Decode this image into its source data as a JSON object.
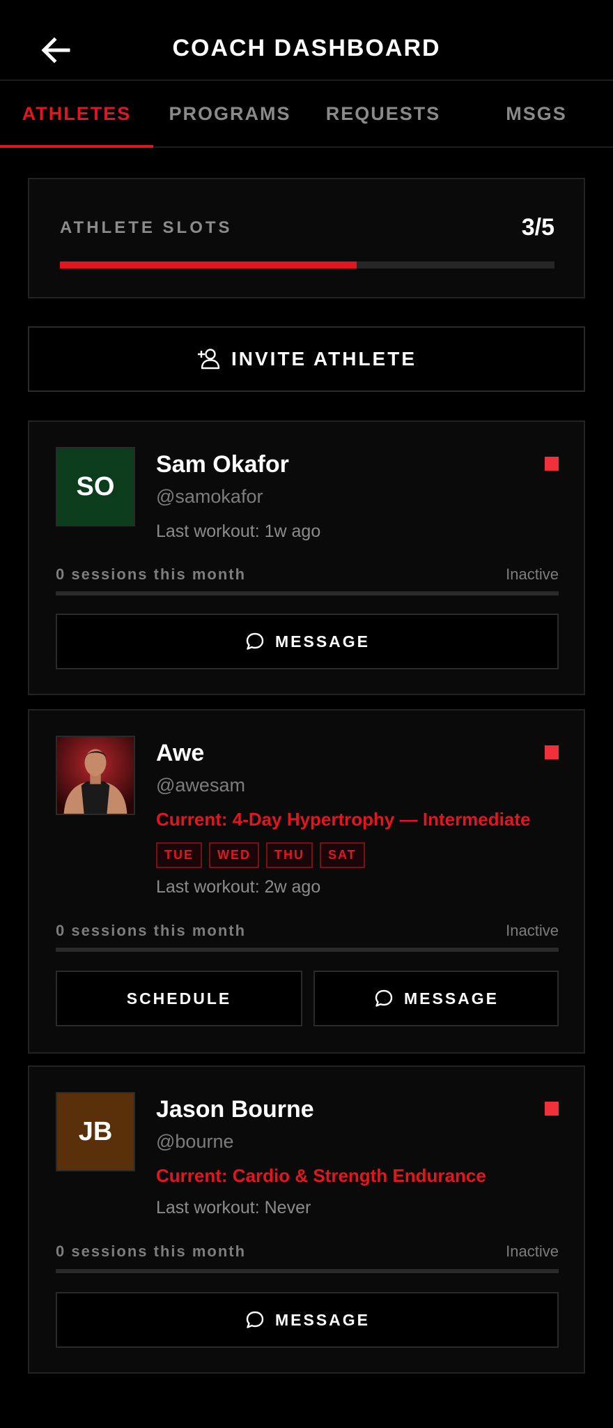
{
  "header": {
    "title": "COACH DASHBOARD",
    "back_icon": "arrow-left-icon"
  },
  "tabs": [
    {
      "label": "ATHLETES",
      "active": true
    },
    {
      "label": "PROGRAMS",
      "active": false
    },
    {
      "label": "REQUESTS",
      "active": false
    },
    {
      "label": "MSGS",
      "active": false
    }
  ],
  "slots": {
    "label": "ATHLETE SLOTS",
    "value": "3/5",
    "used": 3,
    "total": 5
  },
  "invite": {
    "label": "INVITE ATHLETE",
    "icon": "user-plus-icon"
  },
  "athletes": [
    {
      "initials": "SO",
      "avatar_color": "#0b3d1d",
      "name": "Sam Okafor",
      "handle": "@samokafor",
      "last_workout": "Last workout: 1w ago",
      "sessions": "0 sessions this month",
      "status": "Inactive",
      "message_label": "MESSAGE"
    },
    {
      "photo": true,
      "name": "Awe",
      "handle": "@awesam",
      "current": "Current: 4-Day Hypertrophy — Intermediate",
      "days": [
        "TUE",
        "WED",
        "THU",
        "SAT"
      ],
      "last_workout": "Last workout: 2w ago",
      "sessions": "0 sessions this month",
      "status": "Inactive",
      "schedule_label": "SCHEDULE",
      "message_label": "MESSAGE"
    },
    {
      "initials": "JB",
      "avatar_color": "#5a300a",
      "name": "Jason Bourne",
      "handle": "@bourne",
      "current": "Current: Cardio & Strength Endurance",
      "last_workout": "Last workout: Never",
      "sessions": "0 sessions this month",
      "status": "Inactive",
      "message_label": "MESSAGE"
    }
  ],
  "colors": {
    "accent": "#e3161f",
    "status_dot": "#f0303a",
    "background": "#000000",
    "card": "#0a0a0b"
  }
}
